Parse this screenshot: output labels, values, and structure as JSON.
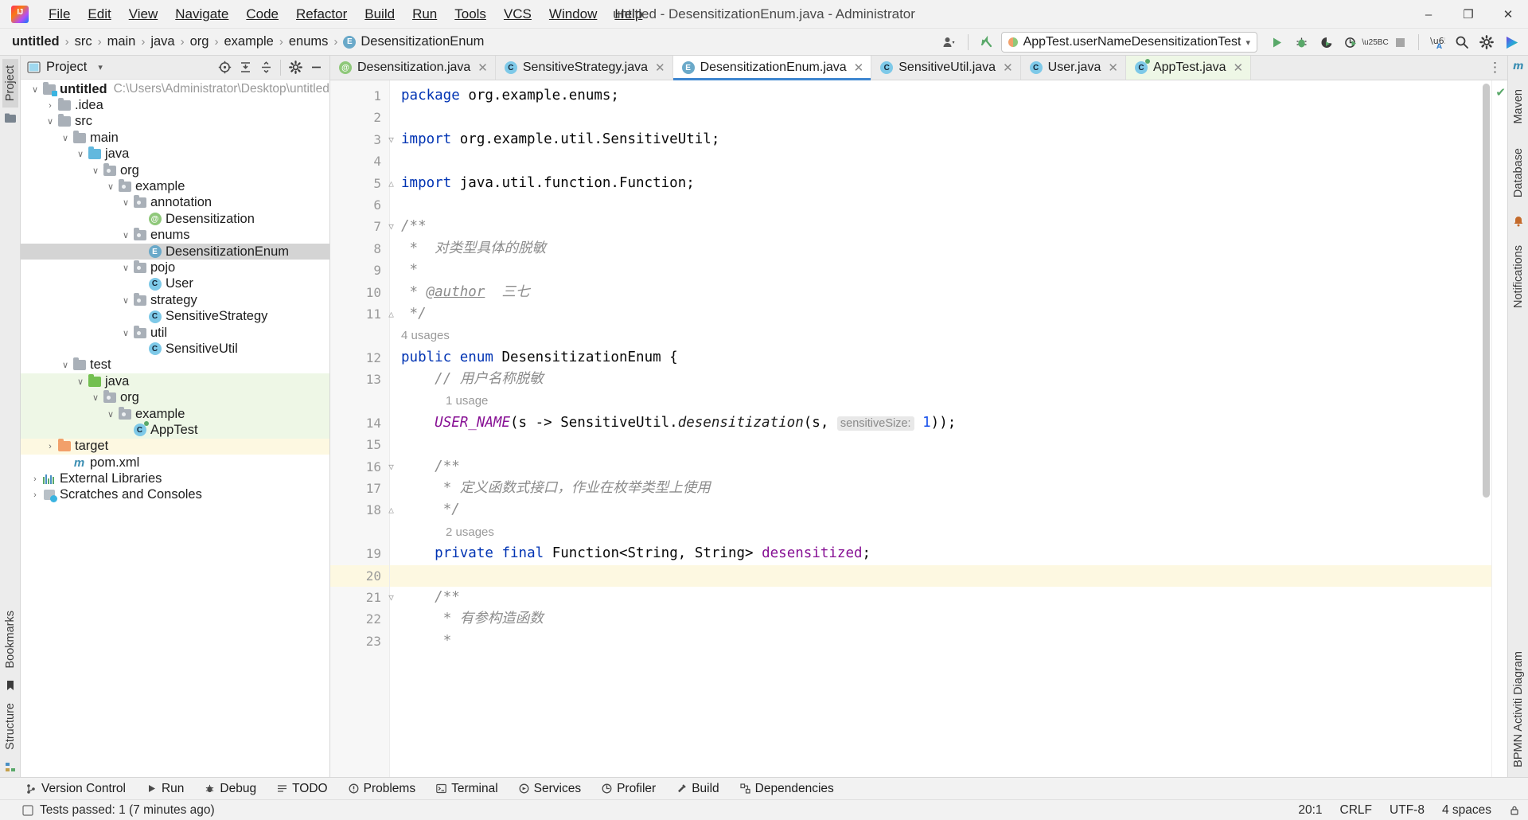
{
  "window": {
    "title": "untitled - DesensitizationEnum.java - Administrator",
    "minimize": "–",
    "maximize": "❐",
    "close": "✕"
  },
  "menu": {
    "items": [
      {
        "label": "File"
      },
      {
        "label": "Edit"
      },
      {
        "label": "View"
      },
      {
        "label": "Navigate"
      },
      {
        "label": "Code"
      },
      {
        "label": "Refactor"
      },
      {
        "label": "Build"
      },
      {
        "label": "Run"
      },
      {
        "label": "Tools"
      },
      {
        "label": "VCS"
      },
      {
        "label": "Window"
      },
      {
        "label": "Help"
      }
    ]
  },
  "navbar": {
    "crumbs": [
      {
        "label": "untitled",
        "bold": true
      },
      {
        "label": "src",
        "bold": false
      },
      {
        "label": "main",
        "bold": false
      },
      {
        "label": "java",
        "bold": false
      },
      {
        "label": "org",
        "bold": false
      },
      {
        "label": "example",
        "bold": false
      },
      {
        "label": "enums",
        "bold": false
      },
      {
        "label": "DesensitizationEnum",
        "bold": false,
        "icon": "enum-badge"
      }
    ],
    "separator": "›",
    "run_config": "AppTest.userNameDesensitizationTest",
    "run_config_caret": "▾"
  },
  "left_strip": {
    "project_tab": "Project",
    "bookmarks_tab": "Bookmarks",
    "structure_tab": "Structure"
  },
  "right_strip": {
    "maven_tab": "Maven",
    "database_tab": "Database",
    "notifications_tab": "Notifications",
    "bpmn_tab": "BPMN Activiti Diagram"
  },
  "project_panel": {
    "title": "Project",
    "caret": "▾",
    "tree": [
      {
        "depth": 0,
        "arrow": "v",
        "icon": "module-folder",
        "label": "untitled",
        "bold": true,
        "path": "C:\\Users\\Administrator\\Desktop\\untitled"
      },
      {
        "depth": 1,
        "arrow": ">",
        "icon": "folder",
        "label": ".idea"
      },
      {
        "depth": 1,
        "arrow": "v",
        "icon": "folder",
        "label": "src"
      },
      {
        "depth": 2,
        "arrow": "v",
        "icon": "folder",
        "label": "main"
      },
      {
        "depth": 3,
        "arrow": "v",
        "icon": "folder-blue",
        "label": "java"
      },
      {
        "depth": 4,
        "arrow": "v",
        "icon": "package",
        "label": "org"
      },
      {
        "depth": 5,
        "arrow": "v",
        "icon": "package",
        "label": "example"
      },
      {
        "depth": 6,
        "arrow": "v",
        "icon": "package",
        "label": "annotation"
      },
      {
        "depth": 7,
        "arrow": "",
        "icon": "annotation-badge",
        "label": "Desensitization"
      },
      {
        "depth": 6,
        "arrow": "v",
        "icon": "package",
        "label": "enums"
      },
      {
        "depth": 7,
        "arrow": "",
        "icon": "enum-badge",
        "label": "DesensitizationEnum",
        "selected": true
      },
      {
        "depth": 6,
        "arrow": "v",
        "icon": "package",
        "label": "pojo"
      },
      {
        "depth": 7,
        "arrow": "",
        "icon": "class-badge",
        "label": "User"
      },
      {
        "depth": 6,
        "arrow": "v",
        "icon": "package",
        "label": "strategy"
      },
      {
        "depth": 7,
        "arrow": "",
        "icon": "class-badge",
        "label": "SensitiveStrategy"
      },
      {
        "depth": 6,
        "arrow": "v",
        "icon": "package",
        "label": "util"
      },
      {
        "depth": 7,
        "arrow": "",
        "icon": "class-badge",
        "label": "SensitiveUtil"
      },
      {
        "depth": 2,
        "arrow": "v",
        "icon": "folder",
        "label": "test"
      },
      {
        "depth": 3,
        "arrow": "v",
        "icon": "folder-green",
        "label": "java",
        "testroot": true
      },
      {
        "depth": 4,
        "arrow": "v",
        "icon": "package",
        "label": "org",
        "testroot": true
      },
      {
        "depth": 5,
        "arrow": "v",
        "icon": "package",
        "label": "example",
        "testroot": true
      },
      {
        "depth": 6,
        "arrow": "",
        "icon": "test-class-badge",
        "label": "AppTest",
        "testroot": true
      },
      {
        "depth": 1,
        "arrow": ">",
        "icon": "folder-orange",
        "label": "target",
        "target": true
      },
      {
        "depth": 2,
        "arrow": "",
        "icon": "maven-badge",
        "label": "pom.xml"
      },
      {
        "depth": 0,
        "arrow": ">",
        "icon": "library",
        "label": "External Libraries"
      },
      {
        "depth": 0,
        "arrow": ">",
        "icon": "scratch",
        "label": "Scratches and Consoles"
      }
    ]
  },
  "editor": {
    "tabs": [
      {
        "label": "Desensitization.java",
        "icon": "annotation-badge",
        "active": false,
        "close": "✕"
      },
      {
        "label": "SensitiveStrategy.java",
        "icon": "class-badge",
        "active": false,
        "close": "✕"
      },
      {
        "label": "DesensitizationEnum.java",
        "icon": "enum-badge",
        "active": true,
        "close": "✕"
      },
      {
        "label": "SensitiveUtil.java",
        "icon": "class-badge",
        "active": false,
        "close": "✕"
      },
      {
        "label": "User.java",
        "icon": "class-badge",
        "active": false,
        "close": "✕"
      },
      {
        "label": "AppTest.java",
        "icon": "test-class-badge",
        "active": false,
        "close": "✕",
        "test": true
      }
    ],
    "tabs_overflow": "⋮",
    "inspection_ok": "✔",
    "lines": [
      {
        "num": "1",
        "fold": "",
        "html": "<span class='kw'>package</span> <span class='plain'>org.example.enums;</span>"
      },
      {
        "num": "2",
        "fold": "",
        "html": ""
      },
      {
        "num": "3",
        "fold": "▽",
        "html": "<span class='kw'>import</span> <span class='plain'>org.example.util.SensitiveUtil;</span>"
      },
      {
        "num": "4",
        "fold": "",
        "html": ""
      },
      {
        "num": "5",
        "fold": "△",
        "html": "<span class='kw'>import</span> <span class='plain'>java.util.function.Function;</span>"
      },
      {
        "num": "6",
        "fold": "",
        "html": ""
      },
      {
        "num": "7",
        "fold": "▽",
        "html": "<span class='cmt'>/**</span>"
      },
      {
        "num": "8",
        "fold": "",
        "html": "<span class='cmt'> *  对类型具体的脱敏</span>"
      },
      {
        "num": "9",
        "fold": "",
        "html": "<span class='cmt'> *</span>"
      },
      {
        "num": "10",
        "fold": "",
        "html": "<span class='cmt'> * <u>@author</u>  三七</span>"
      },
      {
        "num": "11",
        "fold": "△",
        "html": "<span class='cmt'> */</span>"
      },
      {
        "num": "",
        "hint": "4 usages"
      },
      {
        "num": "12",
        "fold": "",
        "html": "<span class='kw'>public</span> <span class='kw'>enum</span> <span class='plain'>DesensitizationEnum {</span>"
      },
      {
        "num": "13",
        "fold": "",
        "html": "    <span class='cmt'>// 用户名称脱敏</span>"
      },
      {
        "num": "",
        "hint": "1 usage",
        "indent": true
      },
      {
        "num": "14",
        "fold": "",
        "html": "    <span class='enumc'>USER_NAME</span><span class='plain'>(s -&gt; SensitiveUtil.</span><span class='mth'>desensitization</span><span class='plain'>(s, </span><span class='param-hint'>sensitiveSize:</span> <span class='num'>1</span><span class='plain'>));</span>"
      },
      {
        "num": "15",
        "fold": "",
        "html": ""
      },
      {
        "num": "16",
        "fold": "▽",
        "html": "    <span class='cmt'>/**</span>"
      },
      {
        "num": "17",
        "fold": "",
        "html": "     <span class='cmt'>* 定义函数式接口，作业在枚举类型上使用</span>"
      },
      {
        "num": "18",
        "fold": "△",
        "html": "     <span class='cmt'>*/</span>"
      },
      {
        "num": "",
        "hint": "2 usages",
        "indent": true
      },
      {
        "num": "19",
        "fold": "",
        "html": "    <span class='kw'>private</span> <span class='kw'>final</span> <span class='plain'>Function&lt;String, String&gt; </span><span class='fld'>desensitized</span><span class='plain'>;</span>"
      },
      {
        "num": "20",
        "fold": "",
        "html": "",
        "highlight": true
      },
      {
        "num": "21",
        "fold": "▽",
        "html": "    <span class='cmt'>/**</span>"
      },
      {
        "num": "22",
        "fold": "",
        "html": "     <span class='cmt'>* 有参构造函数</span>"
      },
      {
        "num": "23",
        "fold": "",
        "html": "     <span class='cmt'>*</span>"
      }
    ]
  },
  "toolwindow_bar": {
    "items": [
      {
        "label": "Version Control",
        "icon": "branch-icon"
      },
      {
        "label": "Run",
        "icon": "run-icon"
      },
      {
        "label": "Debug",
        "icon": "debug-icon"
      },
      {
        "label": "TODO",
        "icon": "todo-icon"
      },
      {
        "label": "Problems",
        "icon": "problems-icon"
      },
      {
        "label": "Terminal",
        "icon": "terminal-icon"
      },
      {
        "label": "Services",
        "icon": "services-icon"
      },
      {
        "label": "Profiler",
        "icon": "profiler-icon"
      },
      {
        "label": "Build",
        "icon": "build-icon"
      },
      {
        "label": "Dependencies",
        "icon": "dependencies-icon"
      }
    ]
  },
  "statusbar": {
    "message": "Tests passed: 1 (7 minutes ago)",
    "caret_position": "20:1",
    "line_separator": "CRLF",
    "encoding": "UTF-8",
    "indent": "4 spaces"
  }
}
